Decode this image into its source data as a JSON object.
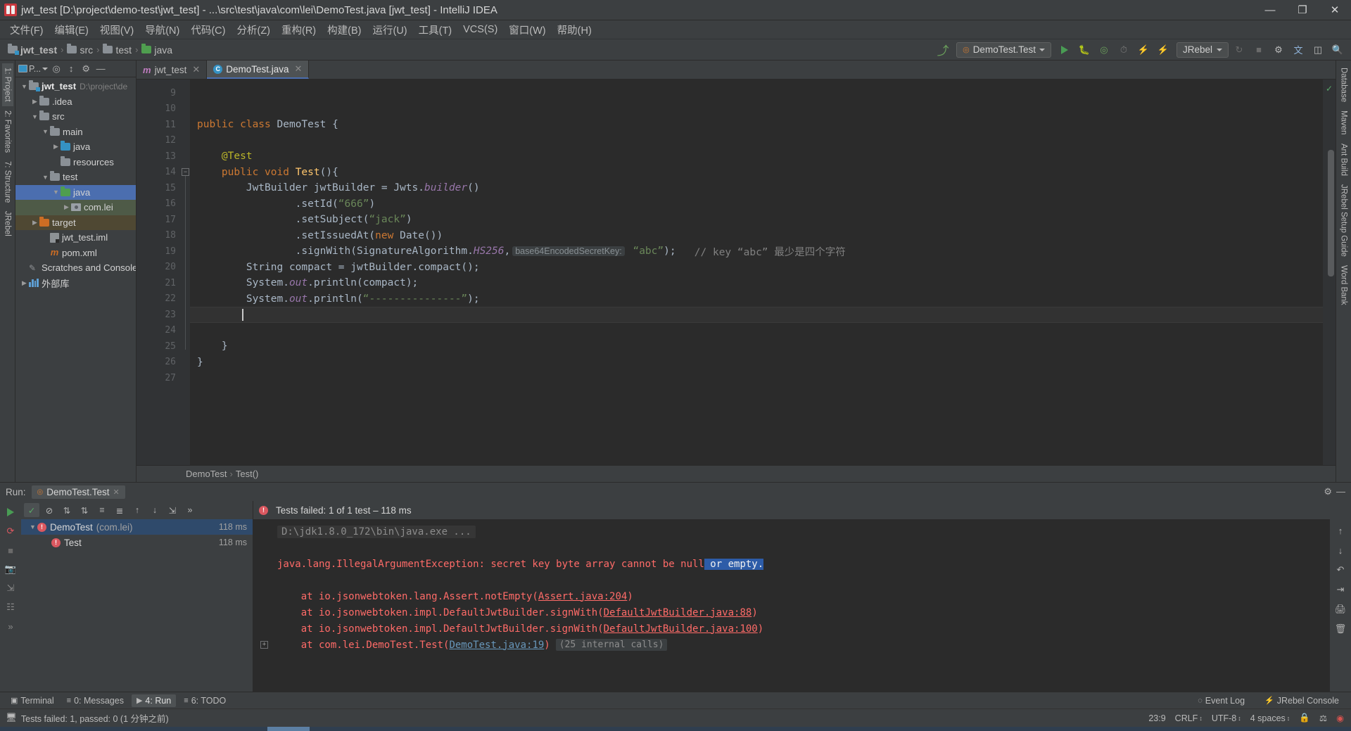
{
  "window": {
    "title": "jwt_test [D:\\project\\demo-test\\jwt_test] - ...\\src\\test\\java\\com\\lei\\DemoTest.java [jwt_test] - IntelliJ IDEA",
    "minimize": "—",
    "maximize": "❐",
    "close": "✕"
  },
  "menubar": {
    "items": [
      {
        "label": "文件(F)"
      },
      {
        "label": "编辑(E)"
      },
      {
        "label": "视图(V)"
      },
      {
        "label": "导航(N)"
      },
      {
        "label": "代码(C)"
      },
      {
        "label": "分析(Z)"
      },
      {
        "label": "重构(R)"
      },
      {
        "label": "构建(B)"
      },
      {
        "label": "运行(U)"
      },
      {
        "label": "工具(T)"
      },
      {
        "label": "VCS(S)"
      },
      {
        "label": "窗口(W)"
      },
      {
        "label": "帮助(H)"
      }
    ]
  },
  "navbar": {
    "breadcrumbs": [
      {
        "label": "jwt_test",
        "sep": "›"
      },
      {
        "label": "src",
        "sep": "›"
      },
      {
        "label": "test",
        "sep": "›"
      },
      {
        "label": "java",
        "sep": ""
      }
    ],
    "run_config": "DemoTest.Test",
    "jrebel_label": "JRebel",
    "icons": {
      "build": "build-icon",
      "run": "run-icon",
      "debug": "debug-icon",
      "run_coverage": "run-with-coverage-icon",
      "profile": "profiler-icon",
      "jrebel_run": "jrebel-run-icon",
      "jrebel_debug": "jrebel-debug-icon",
      "update": "update-icon",
      "stop": "stop-icon",
      "settings": "settings-icon",
      "translate": "translate-icon",
      "layout": "layout-icon",
      "search": "search-icon"
    }
  },
  "left_rail": {
    "tabs": [
      {
        "label": "1: Project",
        "active": true
      },
      {
        "label": "2: Favorites",
        "active": false
      },
      {
        "label": "7: Structure",
        "active": false
      },
      {
        "label": "JRebel",
        "active": false
      }
    ]
  },
  "right_rail": {
    "tabs": [
      {
        "label": "Database"
      },
      {
        "label": "Maven"
      },
      {
        "label": "Ant Build"
      },
      {
        "label": "JRebel Setup Guide"
      },
      {
        "label": "Word Bank"
      }
    ]
  },
  "project_panel": {
    "title": "P...",
    "toolbar_icons": [
      "locate-icon",
      "collapse-all-icon",
      "settings-icon",
      "hide-icon"
    ],
    "tree": [
      {
        "depth": 0,
        "arrow": "▼",
        "icon": "project-folder",
        "label": "jwt_test",
        "bold": true,
        "path": "D:\\project\\de",
        "state": ""
      },
      {
        "depth": 1,
        "arrow": "▶",
        "icon": "folder-gray",
        "label": ".idea",
        "path": "",
        "state": ""
      },
      {
        "depth": 1,
        "arrow": "▼",
        "icon": "folder-gray",
        "label": "src",
        "path": "",
        "state": ""
      },
      {
        "depth": 2,
        "arrow": "▼",
        "icon": "folder-gray",
        "label": "main",
        "path": "",
        "state": ""
      },
      {
        "depth": 3,
        "arrow": "▶",
        "icon": "folder-blue",
        "label": "java",
        "path": "",
        "state": ""
      },
      {
        "depth": 3,
        "arrow": "",
        "icon": "folder-resources",
        "label": "resources",
        "path": "",
        "state": ""
      },
      {
        "depth": 2,
        "arrow": "▼",
        "icon": "folder-gray",
        "label": "test",
        "path": "",
        "state": ""
      },
      {
        "depth": 3,
        "arrow": "▼",
        "icon": "folder-green",
        "label": "java",
        "path": "",
        "state": "selected"
      },
      {
        "depth": 4,
        "arrow": "▶",
        "icon": "package",
        "label": "com.lei",
        "path": "",
        "state": "selected2"
      },
      {
        "depth": 1,
        "arrow": "▶",
        "icon": "folder-orange",
        "label": "target",
        "path": "",
        "state": "selected3"
      },
      {
        "depth": 2,
        "arrow": "",
        "icon": "iml-file",
        "label": "jwt_test.iml",
        "path": "",
        "state": ""
      },
      {
        "depth": 2,
        "arrow": "",
        "icon": "maven-file",
        "label": "pom.xml",
        "path": "",
        "state": ""
      },
      {
        "depth": 0,
        "arrow": "",
        "icon": "scratch",
        "label": "Scratches and Console",
        "path": "",
        "state": ""
      },
      {
        "depth": 0,
        "arrow": "▶",
        "icon": "library",
        "label": "外部库",
        "path": "",
        "state": ""
      }
    ]
  },
  "editor": {
    "tabs": [
      {
        "label": "jwt_test",
        "icon": "maven-module-icon",
        "active": false,
        "close": "✕"
      },
      {
        "label": "DemoTest.java",
        "icon": "java-class-icon",
        "active": true,
        "close": "✕"
      }
    ],
    "breadcrumbs": [
      {
        "label": "DemoTest",
        "sep": "›"
      },
      {
        "label": "Test()",
        "sep": ""
      }
    ],
    "first_line_number": 9,
    "lines": [
      {
        "n": 9,
        "segments": []
      },
      {
        "n": 10,
        "segments": []
      },
      {
        "n": 11,
        "gutter": "breakpoint-run",
        "segments": [
          {
            "t": "public ",
            "c": "kw"
          },
          {
            "t": "class ",
            "c": "kw"
          },
          {
            "t": "DemoTest ",
            "c": "cls"
          },
          {
            "t": "{",
            "c": "plain"
          }
        ]
      },
      {
        "n": 12,
        "segments": []
      },
      {
        "n": 13,
        "segments": [
          {
            "t": "    @Test",
            "c": "anno"
          }
        ]
      },
      {
        "n": 14,
        "gutter": "breakpoint-run",
        "fold": true,
        "segments": [
          {
            "t": "    ",
            "c": "plain"
          },
          {
            "t": "public ",
            "c": "kw"
          },
          {
            "t": "void ",
            "c": "kw"
          },
          {
            "t": "Test",
            "c": "fn"
          },
          {
            "t": "(){",
            "c": "plain"
          }
        ]
      },
      {
        "n": 15,
        "segments": [
          {
            "t": "        JwtBuilder jwtBuilder = Jwts.",
            "c": "plain"
          },
          {
            "t": "builder",
            "c": "stat"
          },
          {
            "t": "()",
            "c": "plain"
          }
        ]
      },
      {
        "n": 16,
        "segments": [
          {
            "t": "                .setId(",
            "c": "plain"
          },
          {
            "t": "“666”",
            "c": "str"
          },
          {
            "t": ")",
            "c": "plain"
          }
        ]
      },
      {
        "n": 17,
        "segments": [
          {
            "t": "                .setSubject(",
            "c": "plain"
          },
          {
            "t": "“jack”",
            "c": "str"
          },
          {
            "t": ")",
            "c": "plain"
          }
        ]
      },
      {
        "n": 18,
        "segments": [
          {
            "t": "                .setIssuedAt(",
            "c": "plain"
          },
          {
            "t": "new ",
            "c": "kw"
          },
          {
            "t": "Date())",
            "c": "plain"
          }
        ]
      },
      {
        "n": 19,
        "segments": [
          {
            "t": "                .signWith(SignatureAlgorithm.",
            "c": "plain"
          },
          {
            "t": "HS256",
            "c": "stat"
          },
          {
            "t": ",",
            "c": "plain"
          },
          {
            "t": "base64EncodedSecretKey:",
            "c": "hint"
          },
          {
            "t": " ",
            "c": "plain"
          },
          {
            "t": "“abc”",
            "c": "str"
          },
          {
            "t": ");",
            "c": "plain"
          },
          {
            "t": "   // key “abc” 最少是四个字符",
            "c": "cmt"
          }
        ]
      },
      {
        "n": 20,
        "segments": [
          {
            "t": "        String compact = jwtBuilder.compact();",
            "c": "plain"
          }
        ]
      },
      {
        "n": 21,
        "segments": [
          {
            "t": "        System.",
            "c": "plain"
          },
          {
            "t": "out",
            "c": "stat"
          },
          {
            "t": ".println(compact);",
            "c": "plain"
          }
        ]
      },
      {
        "n": 22,
        "segments": [
          {
            "t": "        System.",
            "c": "plain"
          },
          {
            "t": "out",
            "c": "stat"
          },
          {
            "t": ".println(",
            "c": "plain"
          },
          {
            "t": "“---------------”",
            "c": "str"
          },
          {
            "t": ");",
            "c": "plain"
          }
        ]
      },
      {
        "n": 23,
        "caret": true,
        "segments": []
      },
      {
        "n": 24,
        "segments": []
      },
      {
        "n": 25,
        "foldend": true,
        "segments": [
          {
            "t": "    }",
            "c": "plain"
          }
        ]
      },
      {
        "n": 26,
        "segments": [
          {
            "t": "}",
            "c": "plain"
          }
        ]
      },
      {
        "n": 27,
        "segments": []
      }
    ]
  },
  "run_window": {
    "label": "Run:",
    "tab_label": "DemoTest.Test",
    "tab_close": "✕",
    "status_text": "Tests failed: 1 of 1 test – 118 ms",
    "toolbar_icons": [
      "rerun-icon",
      "rerun-failed-icon",
      "stop-icon",
      "pause-icon",
      "camera-icon",
      "export-icon",
      "settings-icon",
      "minimize-icon"
    ],
    "test_toolbar_icons": [
      "show-passed-icon",
      "hide-ignored-icon",
      "sort-alphabetically-icon",
      "sort-duration-icon",
      "expand-all-icon",
      "collapse-all-icon",
      "prev-failed-icon",
      "next-failed-icon",
      "export-icon",
      "more-icon"
    ],
    "tests": [
      {
        "depth": 0,
        "arrow": "▼",
        "name": "DemoTest",
        "pkg": "(com.lei)",
        "time": "118 ms",
        "status": "failed",
        "selected": true
      },
      {
        "depth": 1,
        "arrow": "",
        "name": "Test",
        "pkg": "",
        "time": "118 ms",
        "status": "failed",
        "selected": false
      }
    ],
    "console": [
      {
        "type": "cmd",
        "text": "D:\\jdk1.8.0_172\\bin\\java.exe ..."
      },
      {
        "type": "blank",
        "text": ""
      },
      {
        "type": "exception",
        "pre": "java.lang.IllegalArgumentException: secret key byte array cannot be null",
        "sel": " or empty."
      },
      {
        "type": "blank",
        "text": ""
      },
      {
        "type": "trace",
        "pre": "    at io.jsonwebtoken.lang.Assert.notEmpty(",
        "link": "Assert.java:204",
        "post": ")"
      },
      {
        "type": "trace",
        "pre": "    at io.jsonwebtoken.impl.DefaultJwtBuilder.signWith(",
        "link": "DefaultJwtBuilder.java:88",
        "post": ")"
      },
      {
        "type": "trace",
        "pre": "    at io.jsonwebtoken.impl.DefaultJwtBuilder.signWith(",
        "link": "DefaultJwtBuilder.java:100",
        "post": ")"
      },
      {
        "type": "trace-blue",
        "pre": "    at com.lei.DemoTest.Test(",
        "link": "DemoTest.java:19",
        "post": ")",
        "badge": "⟨25 internal calls⟩"
      }
    ]
  },
  "toolwindow_bar": {
    "left": [
      {
        "label": "Terminal",
        "icon": "terminal-icon",
        "active": false
      },
      {
        "label": "0: Messages",
        "icon": "messages-icon",
        "active": false
      },
      {
        "label": "4: Run",
        "icon": "run-icon",
        "active": true
      },
      {
        "label": "6: TODO",
        "icon": "todo-icon",
        "active": false
      }
    ],
    "right": [
      {
        "label": "Event Log",
        "icon": "event-log-icon"
      },
      {
        "label": "JRebel Console",
        "icon": "jrebel-icon"
      }
    ]
  },
  "statusbar": {
    "message": "Tests failed: 1, passed: 0 (1 分钟之前)",
    "caret_position": "23:9",
    "line_separator": "CRLF",
    "encoding": "UTF-8",
    "indent": "4 spaces",
    "icons": [
      "lock-icon",
      "inspections-icon",
      "chrome-icon"
    ]
  },
  "colors": {
    "accent_blue": "#4b6eaf",
    "error_red": "#db5860",
    "console_red": "#ff6b68",
    "success_green": "#499c54",
    "bg_panel": "#3c3f41",
    "bg_editor": "#2b2b2b",
    "string_green": "#6a8759",
    "keyword_orange": "#cc7832"
  }
}
